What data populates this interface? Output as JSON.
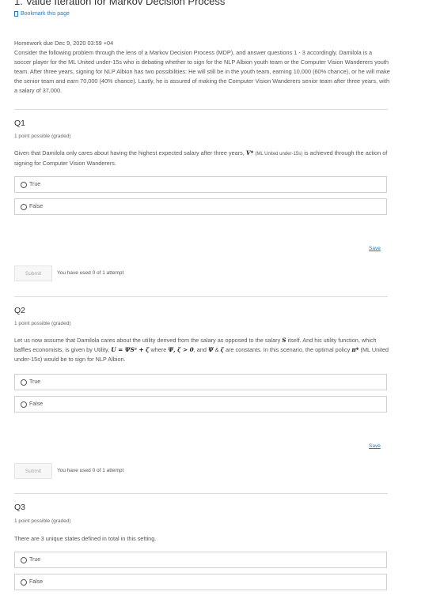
{
  "page_title": "1. Value Iteration for Markov Decision Process",
  "bookmark_label": "Bookmark this page",
  "homework_due": "Homework due Dec 9, 2020 03:59 +04",
  "intro_text": "Consider the following problem through the lens of a Markov Decision Process (MDP), and answer questions 1 - 3 accordingly. Damilola is a soccer player for the ML United under-15s who is debating whether to sign for the NLP Albion youth team or the Computer Vision Wanderers youth team. After three years, signing for NLP Albion has two possibilities: He will still be in the youth team, earning 10,000 (60% chance), or he will make the senior team and earn 70,000 (40% chance). Lastly, he is assured of making the Computer Vision Wanderers senior team after three years, with a salary of 37,000.",
  "questions": [
    {
      "title": "Q1",
      "points": "1 point possible (graded)",
      "text_a": "Given that Damilola only cares about having the highest expected salary after three years,",
      "math_1": "V*",
      "small_1": "(ML United under-15s)",
      "text_b": "is achieved through the action of signing for Computer Vision Wanderers.",
      "options": [
        "True",
        "False"
      ],
      "save_label": "Save",
      "submit_label": "Submit",
      "attempts": "You have used 0 of 1 attempt"
    },
    {
      "title": "Q2",
      "points": "1 point possible (graded)",
      "text_a": "Let us now assume that Damilola cares about the utility derived from the salary as opposed to the salary",
      "math_1": "S",
      "text_b": "itself. And his utility function, which baffles economists, is given by Utility,",
      "math_2": "U = ΨS² + ζ",
      "text_c": "where",
      "math_3": "Ψ, ζ > 0",
      "text_d": ", and",
      "math_4": "Ψ",
      "text_e": "&",
      "math_5": "ζ",
      "text_f": "are constants. In this scenario, the optimal policy",
      "math_6": "π*",
      "text_g": "(ML United under-15s) would be to sign for NLP Albion.",
      "options": [
        "True",
        "False"
      ],
      "save_label": "Save",
      "submit_label": "Submit",
      "attempts": "You have used 0 of 1 attempt"
    },
    {
      "title": "Q3",
      "points": "1 point possible (graded)",
      "text_a": "There are 3 unique states defined in total in this setting.",
      "options": [
        "True",
        "False"
      ]
    }
  ]
}
